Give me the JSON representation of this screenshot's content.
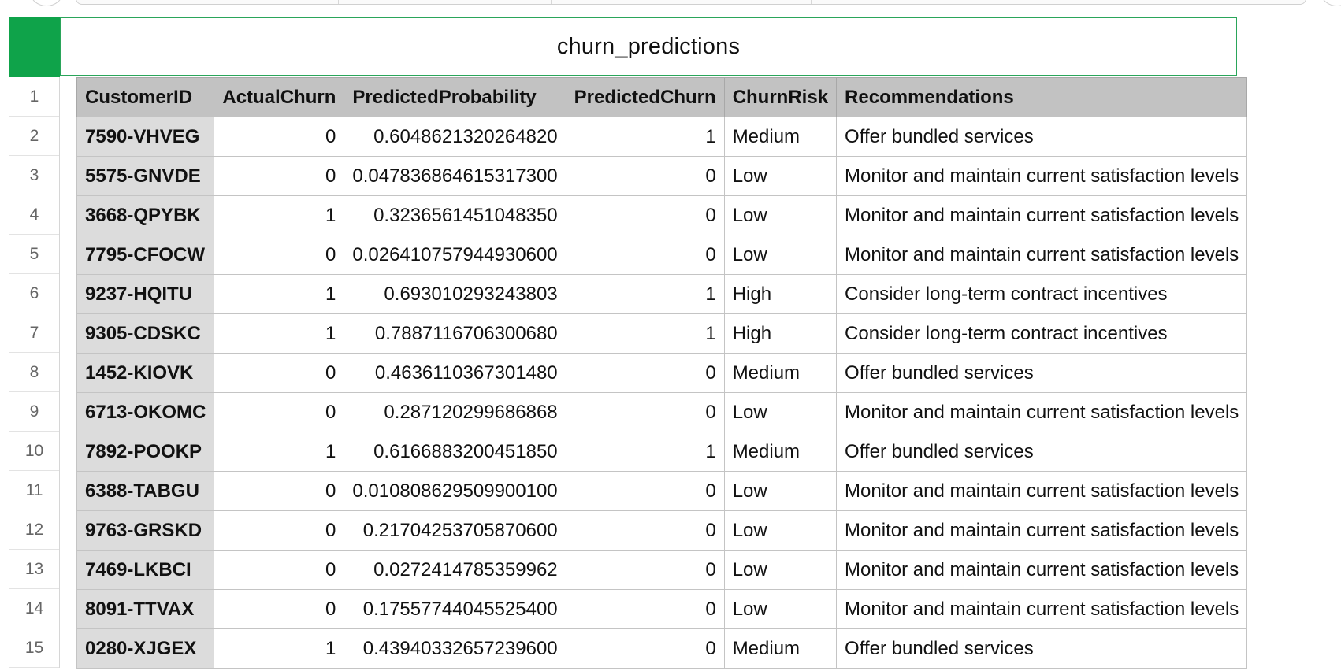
{
  "sheet": {
    "title": "churn_predictions",
    "accent_color": "#0fa34a"
  },
  "table": {
    "headers": [
      "CustomerID",
      "ActualChurn",
      "PredictedProbability",
      "PredictedChurn",
      "ChurnRisk",
      "Recommendations"
    ],
    "row_numbers": [
      "1",
      "2",
      "3",
      "4",
      "5",
      "6",
      "7",
      "8",
      "9",
      "10",
      "11",
      "12",
      "13",
      "14",
      "15"
    ],
    "rows": [
      [
        "7590-VHVEG",
        "0",
        "0.6048621320264820",
        "1",
        "Medium",
        "Offer bundled services"
      ],
      [
        "5575-GNVDE",
        "0",
        "0.047836864615317300",
        "0",
        "Low",
        "Monitor and maintain current satisfaction levels"
      ],
      [
        "3668-QPYBK",
        "1",
        "0.3236561451048350",
        "0",
        "Low",
        "Monitor and maintain current satisfaction levels"
      ],
      [
        "7795-CFOCW",
        "0",
        "0.026410757944930600",
        "0",
        "Low",
        "Monitor and maintain current satisfaction levels"
      ],
      [
        "9237-HQITU",
        "1",
        "0.693010293243803",
        "1",
        "High",
        "Consider long-term contract incentives"
      ],
      [
        "9305-CDSKC",
        "1",
        "0.7887116706300680",
        "1",
        "High",
        "Consider long-term contract incentives"
      ],
      [
        "1452-KIOVK",
        "0",
        "0.4636110367301480",
        "0",
        "Medium",
        "Offer bundled services"
      ],
      [
        "6713-OKOMC",
        "0",
        "0.287120299686868",
        "0",
        "Low",
        "Monitor and maintain current satisfaction levels"
      ],
      [
        "7892-POOKP",
        "1",
        "0.6166883200451850",
        "1",
        "Medium",
        "Offer bundled services"
      ],
      [
        "6388-TABGU",
        "0",
        "0.010808629509900100",
        "0",
        "Low",
        "Monitor and maintain current satisfaction levels"
      ],
      [
        "9763-GRSKD",
        "0",
        "0.21704253705870600",
        "0",
        "Low",
        "Monitor and maintain current satisfaction levels"
      ],
      [
        "7469-LKBCI",
        "0",
        "0.0272414785359962",
        "0",
        "Low",
        "Monitor and maintain current satisfaction levels"
      ],
      [
        "8091-TTVAX",
        "0",
        "0.17557744045525400",
        "0",
        "Low",
        "Monitor and maintain current satisfaction levels"
      ],
      [
        "0280-XJGEX",
        "1",
        "0.43940332657239600",
        "0",
        "Medium",
        "Offer bundled services"
      ]
    ]
  }
}
